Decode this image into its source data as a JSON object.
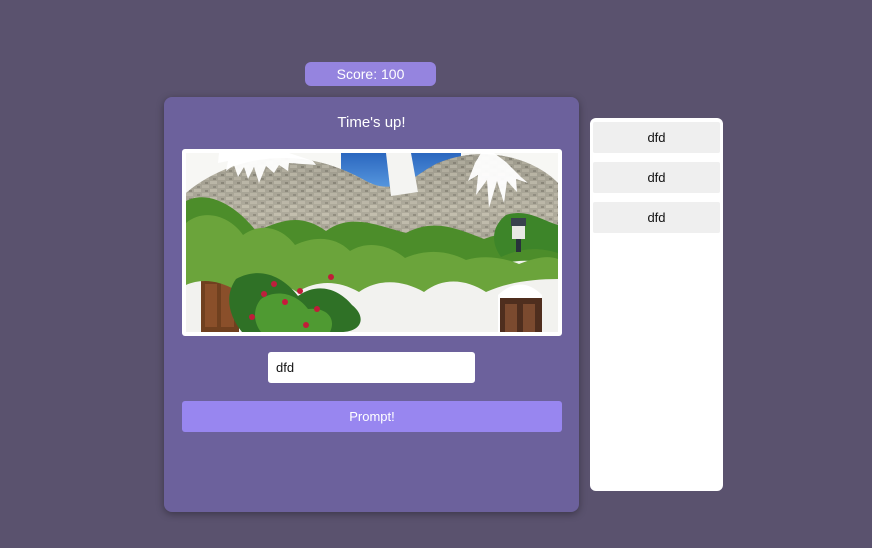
{
  "score": {
    "label": "Score: 100"
  },
  "game": {
    "status": "Time's up!",
    "image_alt": "Trulli houses with cone-shaped stone roofs covered by green vines",
    "input": {
      "value": "dfd",
      "placeholder": ""
    },
    "prompt_button": "Prompt!"
  },
  "history": {
    "items": [
      "dfd",
      "dfd",
      "dfd"
    ]
  },
  "colors": {
    "background": "#5a526e",
    "card": "#6c619c",
    "accent": "#9886f0",
    "score_pill": "#9584df"
  }
}
